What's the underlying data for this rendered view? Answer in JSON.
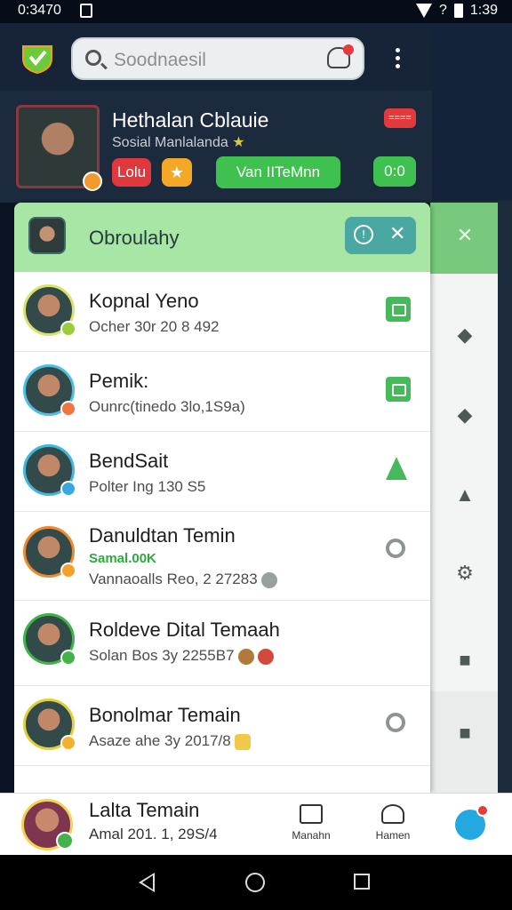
{
  "status_bar": {
    "time_left": "0:3470",
    "time_right": "1:39",
    "signal_label": "?"
  },
  "header": {
    "search_placeholder": "Soodnaesil"
  },
  "profile": {
    "name": "Hethalan Cblauie",
    "subtitle": "Sosial Manlalanda",
    "pill_red": "Lolu",
    "pill_green": "Van IITeMnn",
    "score": "0:0",
    "top_badge": "===="
  },
  "panel": {
    "title": "Obroulahy",
    "contacts": [
      {
        "name": "Kopnal Yeno",
        "sub": "Ocher 30r 20 8 492",
        "status": "",
        "ring": "#d9e36a",
        "badge": "#9ccc3a",
        "icon": "send"
      },
      {
        "name": "Pemik:",
        "sub": "Ounrc(tinedo 3lo,1S9a)",
        "status": "",
        "ring": "#4fbfe0",
        "badge": "#f0763f",
        "icon": "send"
      },
      {
        "name": "BendSait",
        "sub": "Polter Ing 130 S5",
        "status": "",
        "ring": "#42b7de",
        "badge": "#3aa7e0",
        "icon": "tree"
      },
      {
        "name": "Danuldtan Temin",
        "sub": "Vannaoalls Reo, 2 27283",
        "status": "Samal.00K",
        "ring": "#f0882d",
        "badge": "#f3a12d",
        "icon": "ring"
      },
      {
        "name": "Roldeve Dital Temaah",
        "sub": "Solan Bos 3y 2255B7",
        "status": "",
        "ring": "#3fb447",
        "badge": "#3fb447",
        "icon": "none"
      },
      {
        "name": "Bonolmar Temain",
        "sub": "Asaze ahe 3y 2017/8",
        "status": "",
        "ring": "#e2cf3b",
        "badge": "#f3b22d",
        "icon": "ring"
      }
    ]
  },
  "bottom_bar": {
    "name": "Lalta Temain",
    "sub": "Amal 201. 1, 29S/4",
    "tab1": "Manahn",
    "tab2": "Hamen"
  }
}
